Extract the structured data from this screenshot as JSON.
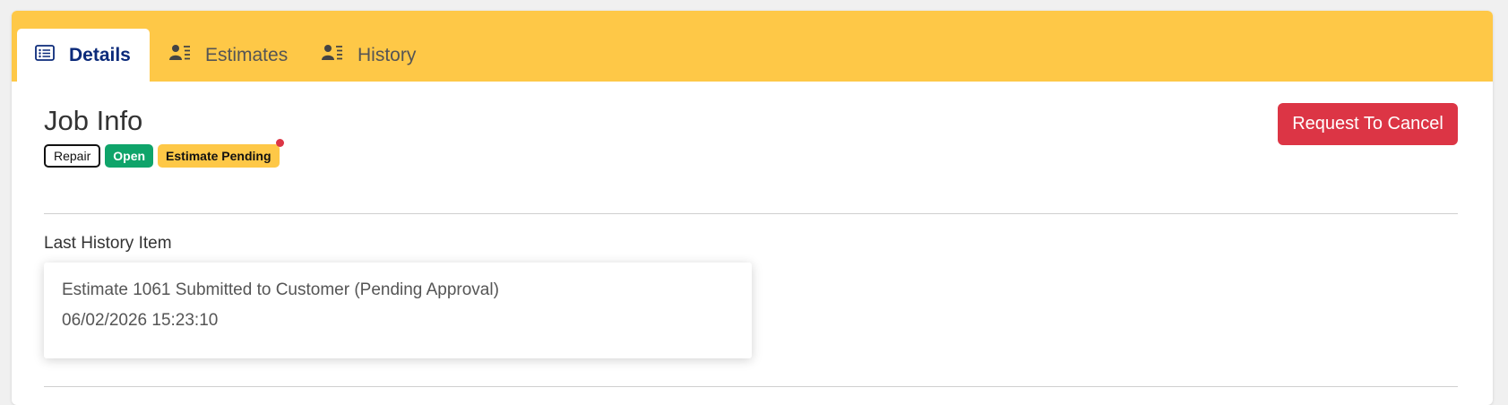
{
  "tabs": [
    {
      "label": "Details",
      "icon": "list-icon",
      "active": true
    },
    {
      "label": "Estimates",
      "icon": "user-list-icon",
      "active": false
    },
    {
      "label": "History",
      "icon": "user-list-icon",
      "active": false
    }
  ],
  "job": {
    "title": "Job Info",
    "badges": {
      "type": "Repair",
      "status": "Open",
      "estimate_status": "Estimate Pending"
    }
  },
  "actions": {
    "request_cancel_label": "Request To Cancel"
  },
  "history": {
    "label": "Last History Item",
    "item_text": "Estimate 1061 Submitted to Customer (Pending Approval)",
    "item_date": "06/02/2026 15:23:10"
  },
  "colors": {
    "tab_bar": "#fec847",
    "active_tab_text": "#0b2a7a",
    "open_badge": "#0fa46a",
    "pending_badge": "#fec847",
    "cancel_button": "#dc3545",
    "notification_dot": "#dc3545"
  }
}
